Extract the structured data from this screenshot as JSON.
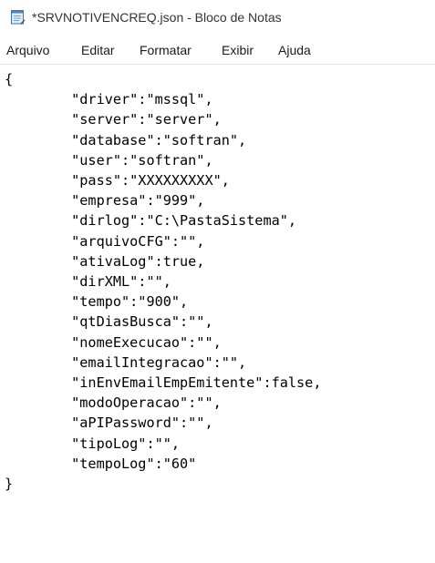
{
  "window": {
    "title": "*SRVNOTIVENCREQ.json - Bloco de Notas",
    "icon": "notepad-icon"
  },
  "menu": {
    "items": [
      {
        "label": "Arquivo"
      },
      {
        "label": "Editar"
      },
      {
        "label": "Formatar"
      },
      {
        "label": "Exibir"
      },
      {
        "label": "Ajuda"
      }
    ]
  },
  "editor": {
    "content": "{\n        \"driver\":\"mssql\",\n        \"server\":\"server\",\n        \"database\":\"softran\",\n        \"user\":\"softran\",\n        \"pass\":\"XXXXXXXXX\",\n        \"empresa\":\"999\",\n        \"dirlog\":\"C:\\PastaSistema\",\n        \"arquivoCFG\":\"\",\n        \"ativaLog\":true,\n        \"dirXML\":\"\",\n        \"tempo\":\"900\",\n        \"qtDiasBusca\":\"\",\n        \"nomeExecucao\":\"\",\n        \"emailIntegracao\":\"\",\n        \"inEnvEmailEmpEmitente\":false,\n        \"modoOperacao\":\"\",\n        \"aPIPassword\":\"\",\n        \"tipoLog\":\"\",\n        \"tempoLog\":\"60\"\n}"
  }
}
